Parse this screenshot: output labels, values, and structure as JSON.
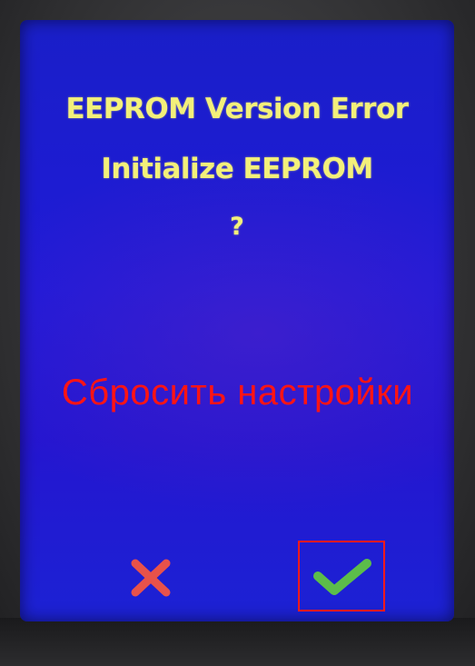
{
  "dialog": {
    "title": "EEPROM Version Error",
    "message": "Initialize EEPROM",
    "question_mark": "?"
  },
  "annotation": {
    "text": "Сбросить настройки",
    "color": "#ff1414"
  },
  "buttons": {
    "cancel_icon": "close-icon",
    "cancel_color": "#e8524a",
    "confirm_icon": "checkmark-icon",
    "confirm_color": "#5cbd4a"
  },
  "colors": {
    "screen_background": "#1f1ad8",
    "text": "#f3f07a",
    "highlight": "#ff1a1a"
  }
}
